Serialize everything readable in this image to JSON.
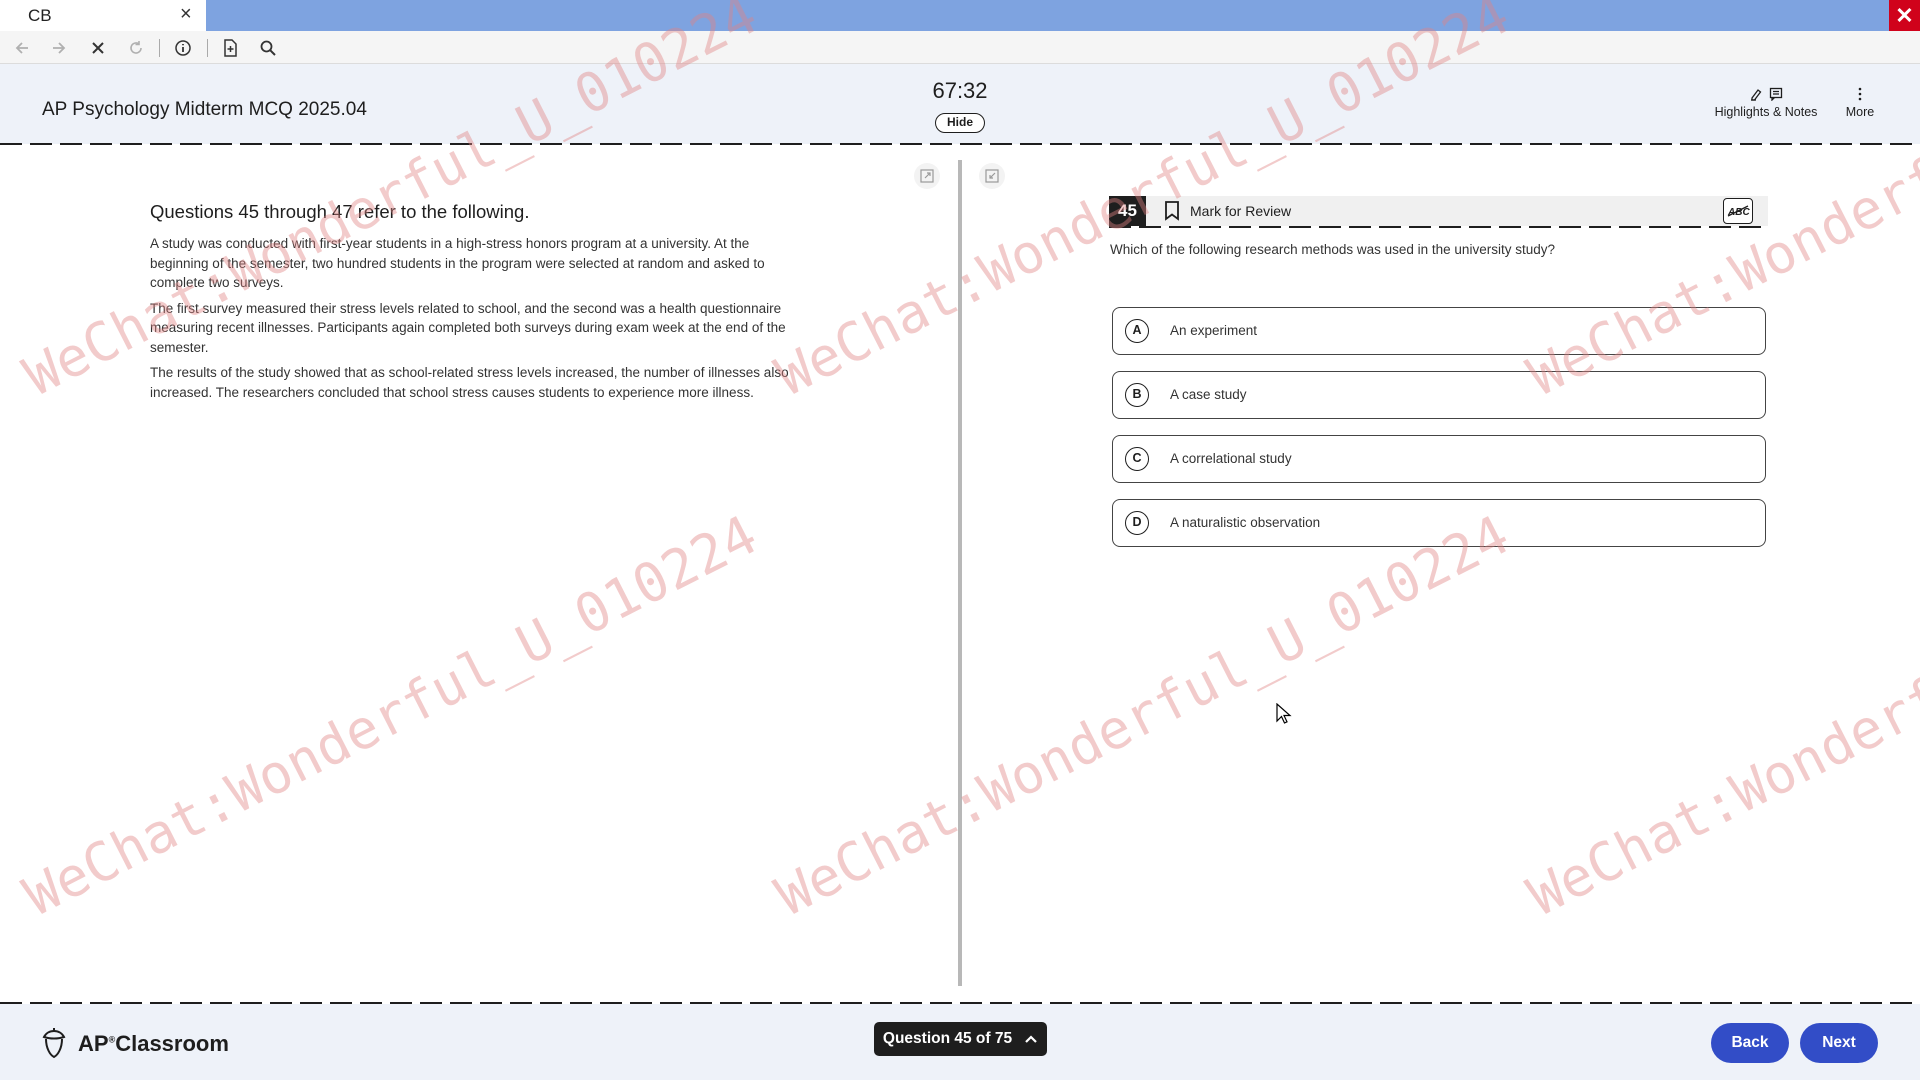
{
  "browser": {
    "tab_title": "CB",
    "tab_close_icon": "×",
    "window_close_icon": "✕"
  },
  "header": {
    "exam_title": "AP Psychology Midterm MCQ 2025.04",
    "timer": "67:32",
    "hide_label": "Hide",
    "highlights_notes_label": "Highlights & Notes",
    "more_label": "More"
  },
  "passage": {
    "heading": "Questions 45 through 47 refer to the following.",
    "paragraphs": [
      "A study was conducted with first-year students in a high-stress honors program at a university. At the beginning of the semester, two hundred students in the program were selected at random and asked to complete two surveys.",
      "The first survey measured their stress levels related to school, and the second was a health questionnaire measuring recent illnesses. Participants again completed both surveys during exam week at the end of the semester.",
      "The results of the study showed that as school-related stress levels increased, the number of illnesses also increased. The researchers concluded that school stress causes students to experience more illness."
    ]
  },
  "question": {
    "number": "45",
    "mark_for_review_label": "Mark for Review",
    "stem": "Which of the following research methods was used in the university study?",
    "options": [
      {
        "letter": "A",
        "text": "An experiment"
      },
      {
        "letter": "B",
        "text": "A case study"
      },
      {
        "letter": "C",
        "text": "A correlational study"
      },
      {
        "letter": "D",
        "text": "A naturalistic observation"
      }
    ]
  },
  "footer": {
    "brand_ap": "AP",
    "brand_reg": "®",
    "brand_classroom": "Classroom",
    "question_nav_label": "Question 45 of 75",
    "back_label": "Back",
    "next_label": "Next"
  },
  "watermark": {
    "text": "WeChat:Wonderful_U_010224",
    "color": "#e18282"
  },
  "colors": {
    "header_bg": "#eef2f9",
    "tabstrip_bg": "#7ea3e0",
    "primary_button": "#324dc7",
    "window_close": "#d0021b",
    "dark": "#1e1e1e"
  },
  "icons": {
    "nav_back": "arrow-left-icon",
    "nav_forward": "arrow-right-icon",
    "stop": "stop-icon",
    "reload": "reload-icon",
    "info": "info-icon",
    "page": "page-icon",
    "search": "search-icon",
    "highlighter": "highlighter-icon",
    "notes": "notes-icon",
    "more": "vertical-dots-icon",
    "expand": "expand-icon",
    "collapse": "collapse-icon",
    "bookmark": "bookmark-icon",
    "abc_strikethrough": "abc-strikethrough-icon",
    "chevron_up": "chevron-up-icon",
    "ap_logo": "ap-acorn-logo",
    "cursor": "mouse-cursor-icon"
  }
}
